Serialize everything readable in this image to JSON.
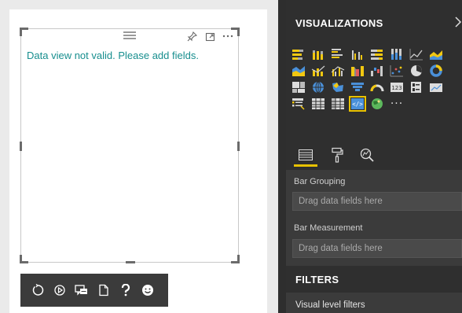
{
  "canvas": {
    "message": "Data view not valid. Please add fields."
  },
  "floating_toolbar": {
    "items": [
      "refresh-icon",
      "play-icon",
      "comment-icon",
      "export-icon",
      "help-icon",
      "smiley-icon"
    ]
  },
  "visualizations": {
    "title": "VISUALIZATIONS",
    "selected_tile_icon": "custom-visual-icon",
    "more_label": "···",
    "tabs": [
      "fields-tab-icon",
      "format-tab-icon",
      "analytics-tab-icon"
    ]
  },
  "wells": {
    "bar_grouping": {
      "label": "Bar Grouping",
      "placeholder": "Drag data fields here"
    },
    "bar_measurement": {
      "label": "Bar Measurement",
      "placeholder": "Drag data fields here"
    }
  },
  "filters": {
    "title": "FILTERS",
    "visual_level": "Visual level filters"
  },
  "colors": {
    "message": "#178e8e",
    "accent": "#e8c200",
    "pane": "#3b3b3b",
    "pane_dark": "#2f2f2f"
  }
}
